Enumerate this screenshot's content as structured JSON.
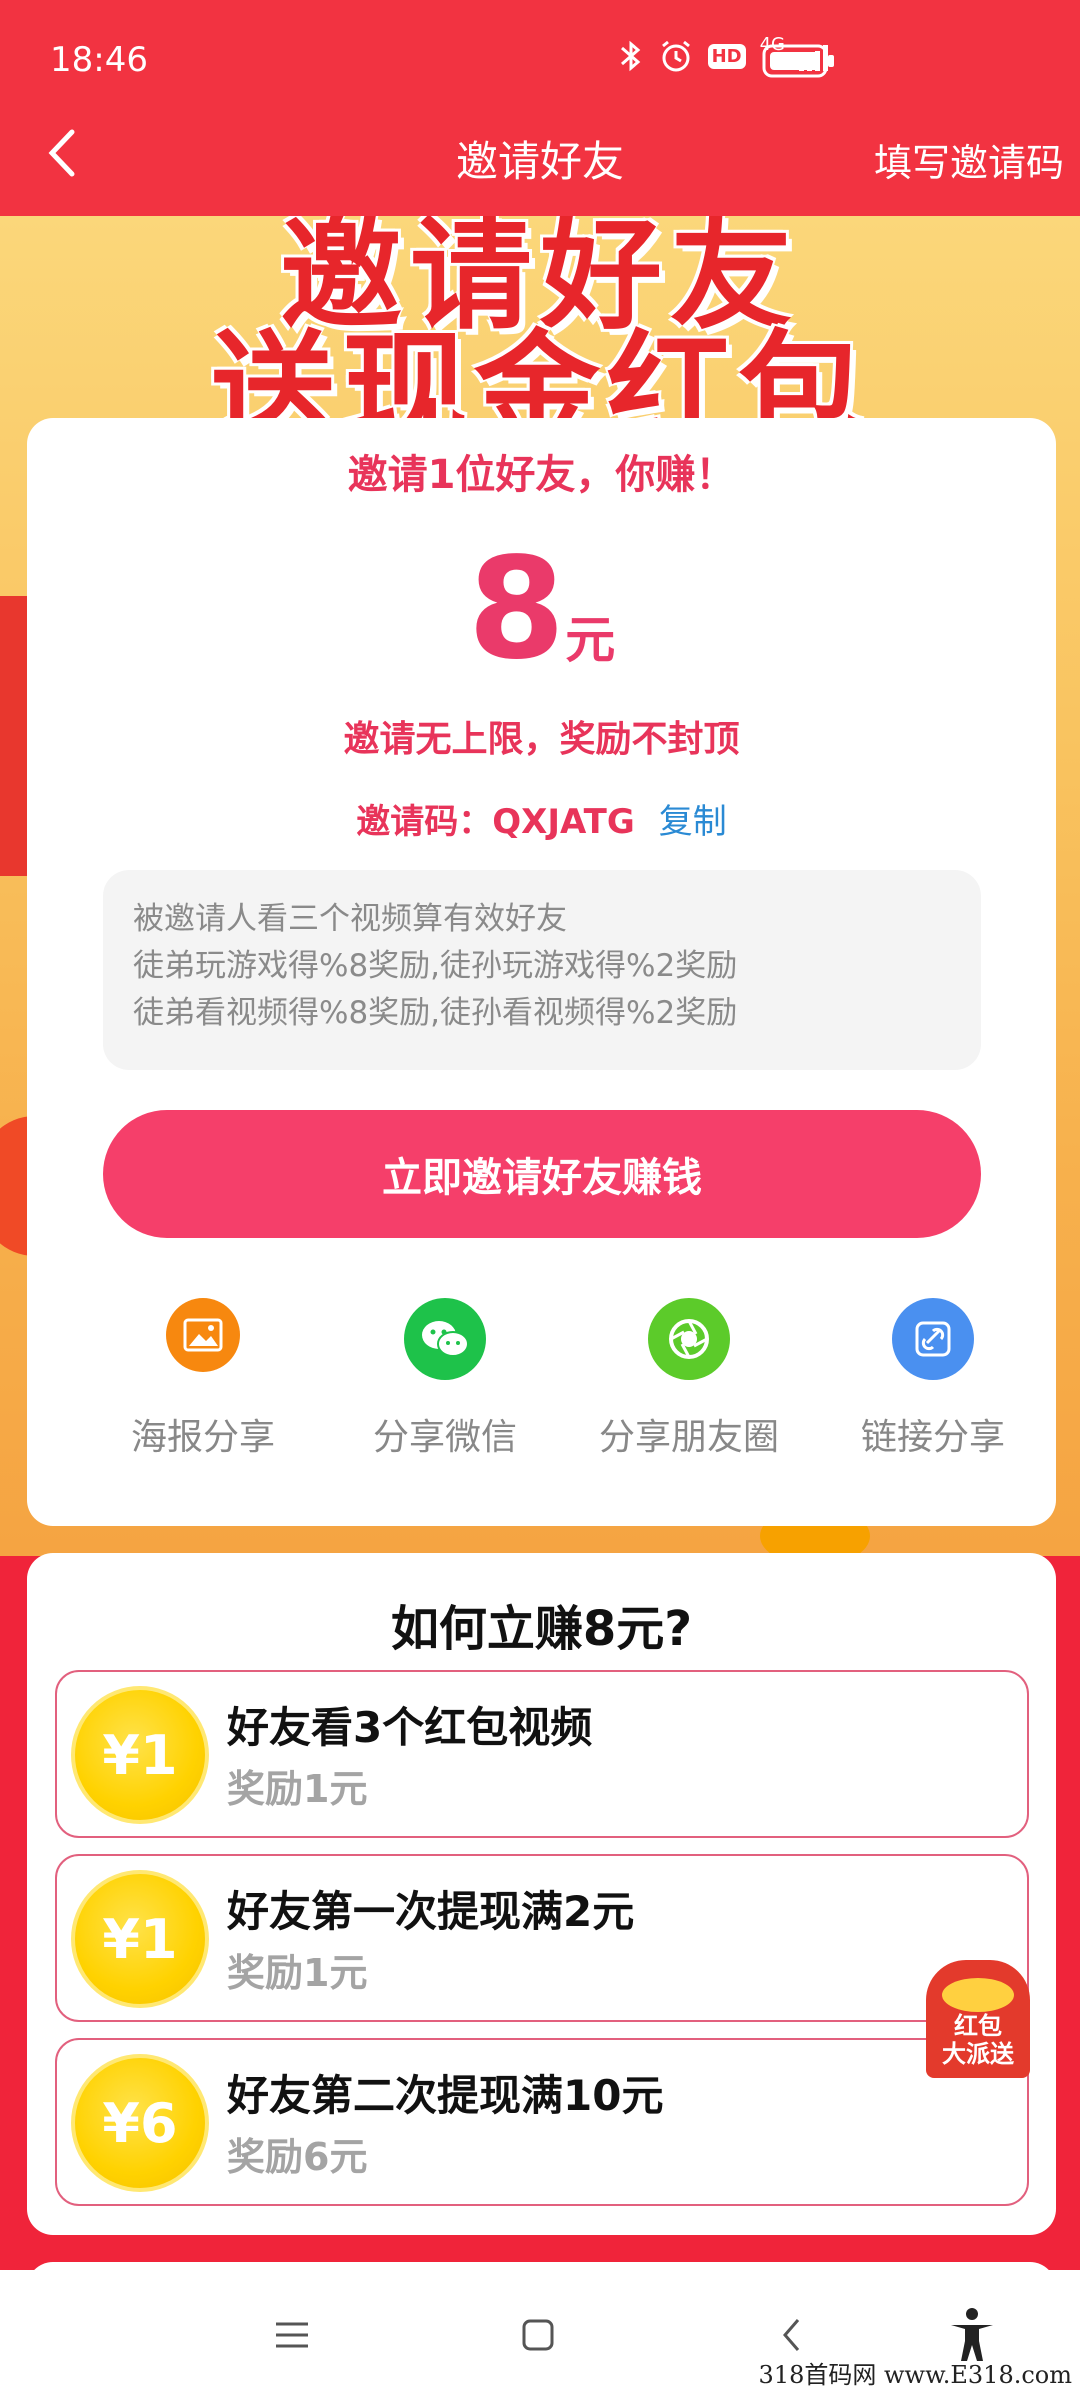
{
  "status_bar": {
    "time": "18:46",
    "network": "4G",
    "hd": "HD"
  },
  "header": {
    "title": "邀请好友",
    "right_action": "填写邀请码"
  },
  "banner": {
    "line1": "邀请好友",
    "line2": "送现金红包"
  },
  "invite_card": {
    "headline": "邀请1位好友，你赚！",
    "amount": "8",
    "amount_unit": "元",
    "unlimited": "邀请无上限，奖励不封顶",
    "code_label": "邀请码：",
    "code_value": "QXJATG",
    "copy_label": "复制",
    "rules": [
      "被邀请人看三个视频算有效好友",
      "徒弟玩游戏得%8奖励,徒孙玩游戏得%2奖励",
      "徒弟看视频得%8奖励,徒孙看视频得%2奖励"
    ],
    "invite_button": "立即邀请好友赚钱",
    "share_options": [
      {
        "label": "海报分享",
        "icon": "poster-icon",
        "color": "#f7880f"
      },
      {
        "label": "分享微信",
        "icon": "wechat-icon",
        "color": "#1ec24a"
      },
      {
        "label": "分享朋友圈",
        "icon": "moments-icon",
        "color": "#5ccb2a"
      },
      {
        "label": "链接分享",
        "icon": "link-icon",
        "color": "#4a90f0"
      }
    ]
  },
  "how_to_earn": {
    "title": "如何立赚8元?",
    "tasks": [
      {
        "coin": "¥1",
        "title": "好友看3个红包视频",
        "reward": "奖励1元"
      },
      {
        "coin": "¥1",
        "title": "好友第一次提现满2元",
        "reward": "奖励1元"
      },
      {
        "coin": "¥6",
        "title": "好友第二次提现满10元",
        "reward": "奖励6元"
      }
    ]
  },
  "floating_badge": {
    "line1": "红包",
    "line2": "大派送"
  },
  "watermark": "318首码网 www.E318.com",
  "colors": {
    "header_red": "#f23341",
    "accent_pink": "#f53f6a",
    "coin_gold": "#ffd200",
    "copy_blue": "#2a8ad4"
  }
}
